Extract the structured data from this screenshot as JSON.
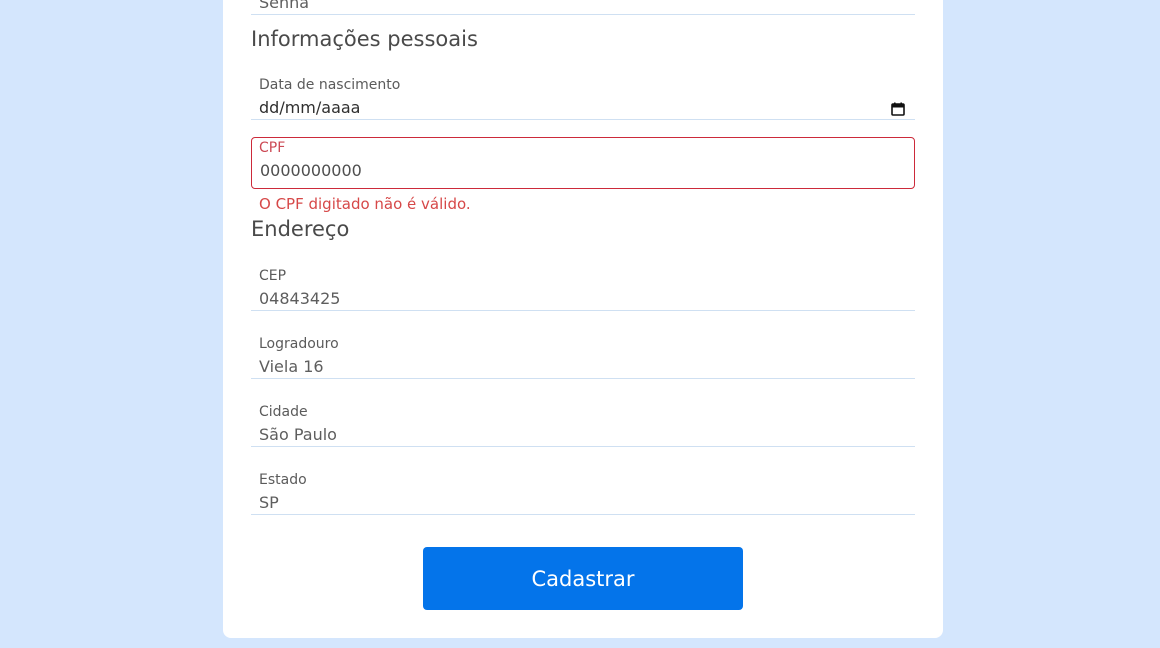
{
  "form": {
    "top_field": {
      "value": "Senha"
    },
    "personal": {
      "title": "Informações pessoais",
      "birth": {
        "label": "Data de nascimento",
        "placeholder": "dd/mm/aaaa"
      },
      "cpf": {
        "label": "CPF",
        "value": "0000000000",
        "error": "O CPF digitado não é válido."
      }
    },
    "address": {
      "title": "Endereço",
      "cep": {
        "label": "CEP",
        "value": "04843425"
      },
      "street": {
        "label": "Logradouro",
        "value": "Viela 16"
      },
      "city": {
        "label": "Cidade",
        "value": "São Paulo"
      },
      "state": {
        "label": "Estado",
        "value": "SP"
      }
    },
    "submit_label": "Cadastrar",
    "icons": {
      "date_picker": "calendar-icon"
    },
    "colors": {
      "background": "#d4e6fd",
      "primary": "#0474ea",
      "error": "#cc2a3a"
    }
  }
}
